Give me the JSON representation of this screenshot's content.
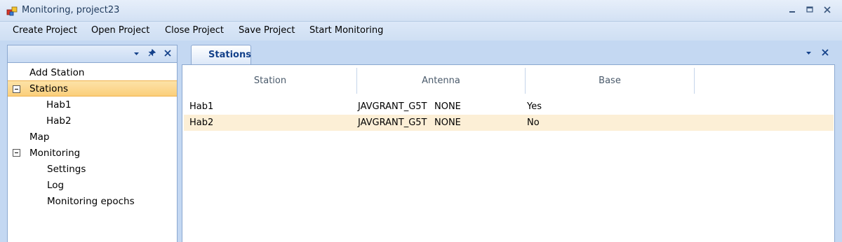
{
  "window": {
    "title": "Monitoring, project23"
  },
  "menu": [
    "Create Project",
    "Open Project",
    "Close Project",
    "Save Project",
    "Start Monitoring"
  ],
  "tree": {
    "items": [
      {
        "label": "Add Station",
        "indent": 0
      },
      {
        "label": "Stations",
        "indent": 0,
        "expander": true,
        "selected": true
      },
      {
        "label": "Hab1",
        "indent": 1
      },
      {
        "label": "Hab2",
        "indent": 1
      },
      {
        "label": "Map",
        "indent": 0
      },
      {
        "label": "Monitoring",
        "indent": 0,
        "expander": true
      },
      {
        "label": "Settings",
        "indent": 2
      },
      {
        "label": "Log",
        "indent": 2
      },
      {
        "label": "Monitoring epochs",
        "indent": 2
      }
    ]
  },
  "tab": {
    "label": "Stations"
  },
  "grid": {
    "columns": [
      "Station",
      "Antenna",
      "Base"
    ],
    "rows": [
      {
        "station": "Hab1",
        "antenna": "JAVGRANT_G5T",
        "antenna_type": "NONE",
        "base": "Yes"
      },
      {
        "station": "Hab2",
        "antenna": "JAVGRANT_G5T",
        "antenna_type": "NONE",
        "base": "No"
      }
    ]
  },
  "colors": {
    "selection": "#fbcf7b",
    "row_highlight": "#fcefd6",
    "accent": "#15428b"
  }
}
